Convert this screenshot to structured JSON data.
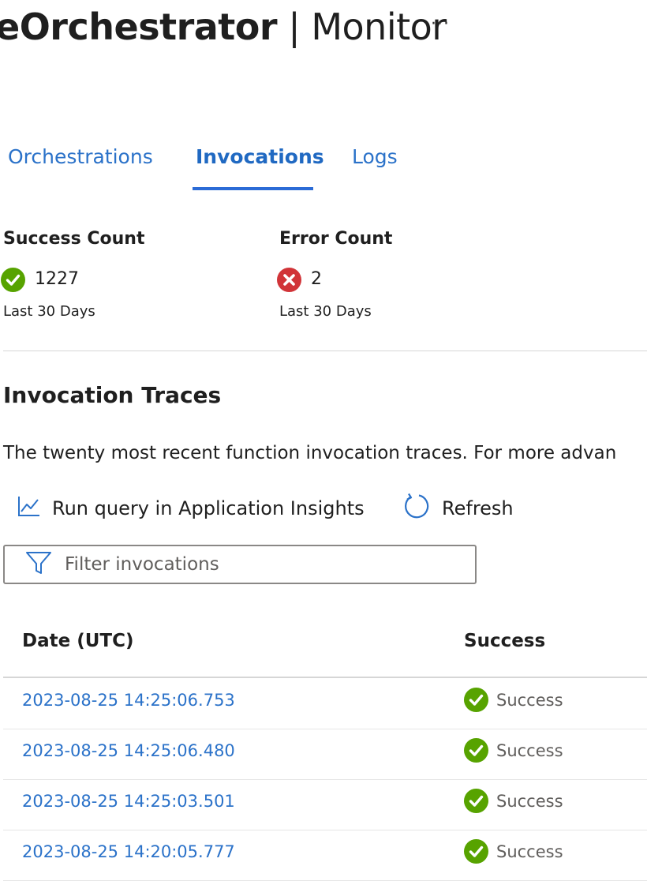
{
  "header": {
    "title_name": "eOrchestrator",
    "title_separator": "|",
    "title_section": "Monitor",
    "more_label": "···"
  },
  "tabs": [
    {
      "label": "Orchestrations",
      "active": false
    },
    {
      "label": "Invocations",
      "active": true
    },
    {
      "label": "Logs",
      "active": false
    }
  ],
  "stats": {
    "success": {
      "title": "Success Count",
      "value": "1227",
      "period": "Last 30 Days",
      "icon": "check-circle-icon"
    },
    "error": {
      "title": "Error Count",
      "value": "2",
      "period": "Last 30 Days",
      "icon": "error-circle-icon"
    }
  },
  "traces": {
    "title": "Invocation Traces",
    "description": "The twenty most recent function invocation traces. For more advan"
  },
  "toolbar": {
    "run_query_label": "Run query in Application Insights",
    "run_query_icon": "chart-line-icon",
    "refresh_label": "Refresh",
    "refresh_icon": "refresh-icon"
  },
  "filter": {
    "placeholder": "Filter invocations",
    "value": "",
    "icon": "filter-icon"
  },
  "table": {
    "columns": [
      "Date (UTC)",
      "Success"
    ],
    "rows": [
      {
        "date": "2023-08-25 14:25:06.753",
        "status": "Success"
      },
      {
        "date": "2023-08-25 14:25:06.480",
        "status": "Success"
      },
      {
        "date": "2023-08-25 14:25:03.501",
        "status": "Success"
      },
      {
        "date": "2023-08-25 14:20:05.777",
        "status": "Success"
      }
    ]
  },
  "colors": {
    "link_blue": "#2b72c9",
    "tab_underline": "#2b6bd6",
    "success_green": "#57a300",
    "error_red": "#d13438"
  }
}
